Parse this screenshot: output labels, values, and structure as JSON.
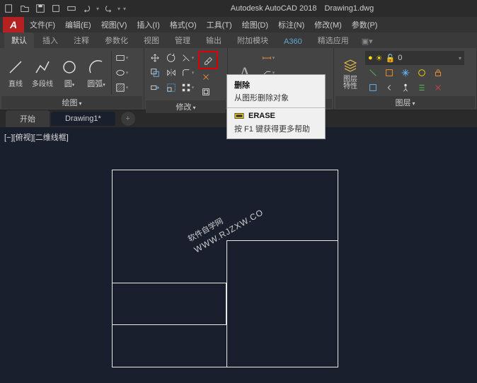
{
  "title": {
    "app": "Autodesk AutoCAD 2018",
    "file": "Drawing1.dwg"
  },
  "menubar": [
    {
      "label": "文件(F)"
    },
    {
      "label": "编辑(E)"
    },
    {
      "label": "视图(V)"
    },
    {
      "label": "插入(I)"
    },
    {
      "label": "格式(O)"
    },
    {
      "label": "工具(T)"
    },
    {
      "label": "绘图(D)"
    },
    {
      "label": "标注(N)"
    },
    {
      "label": "修改(M)"
    },
    {
      "label": "参数(P)"
    }
  ],
  "ribbon_tabs": [
    {
      "label": "默认",
      "active": true
    },
    {
      "label": "插入"
    },
    {
      "label": "注释"
    },
    {
      "label": "参数化"
    },
    {
      "label": "视图"
    },
    {
      "label": "管理"
    },
    {
      "label": "输出"
    },
    {
      "label": "附加模块"
    },
    {
      "label": "A360",
      "special": true
    },
    {
      "label": "精选应用"
    }
  ],
  "panels": {
    "draw": {
      "label": "绘图",
      "line": "直线",
      "polyline": "多段线",
      "circle": "圆",
      "arc": "圆弧"
    },
    "modify": {
      "label": "修改"
    },
    "annotation": {
      "letter": "A"
    },
    "layers": {
      "label": "图层",
      "props": "图层\n特性",
      "current": "0"
    }
  },
  "doc_tabs": {
    "start": "开始",
    "drawing": "Drawing1*",
    "add": "+"
  },
  "view_label": "[−][俯视][二维线框]",
  "tooltip": {
    "title": "删除",
    "desc": "从图形删除对象",
    "cmd": "ERASE",
    "help": "按 F1 键获得更多帮助"
  },
  "watermark": {
    "main": "软件自学网",
    "sub": "WWW.RJZXW.CO"
  }
}
